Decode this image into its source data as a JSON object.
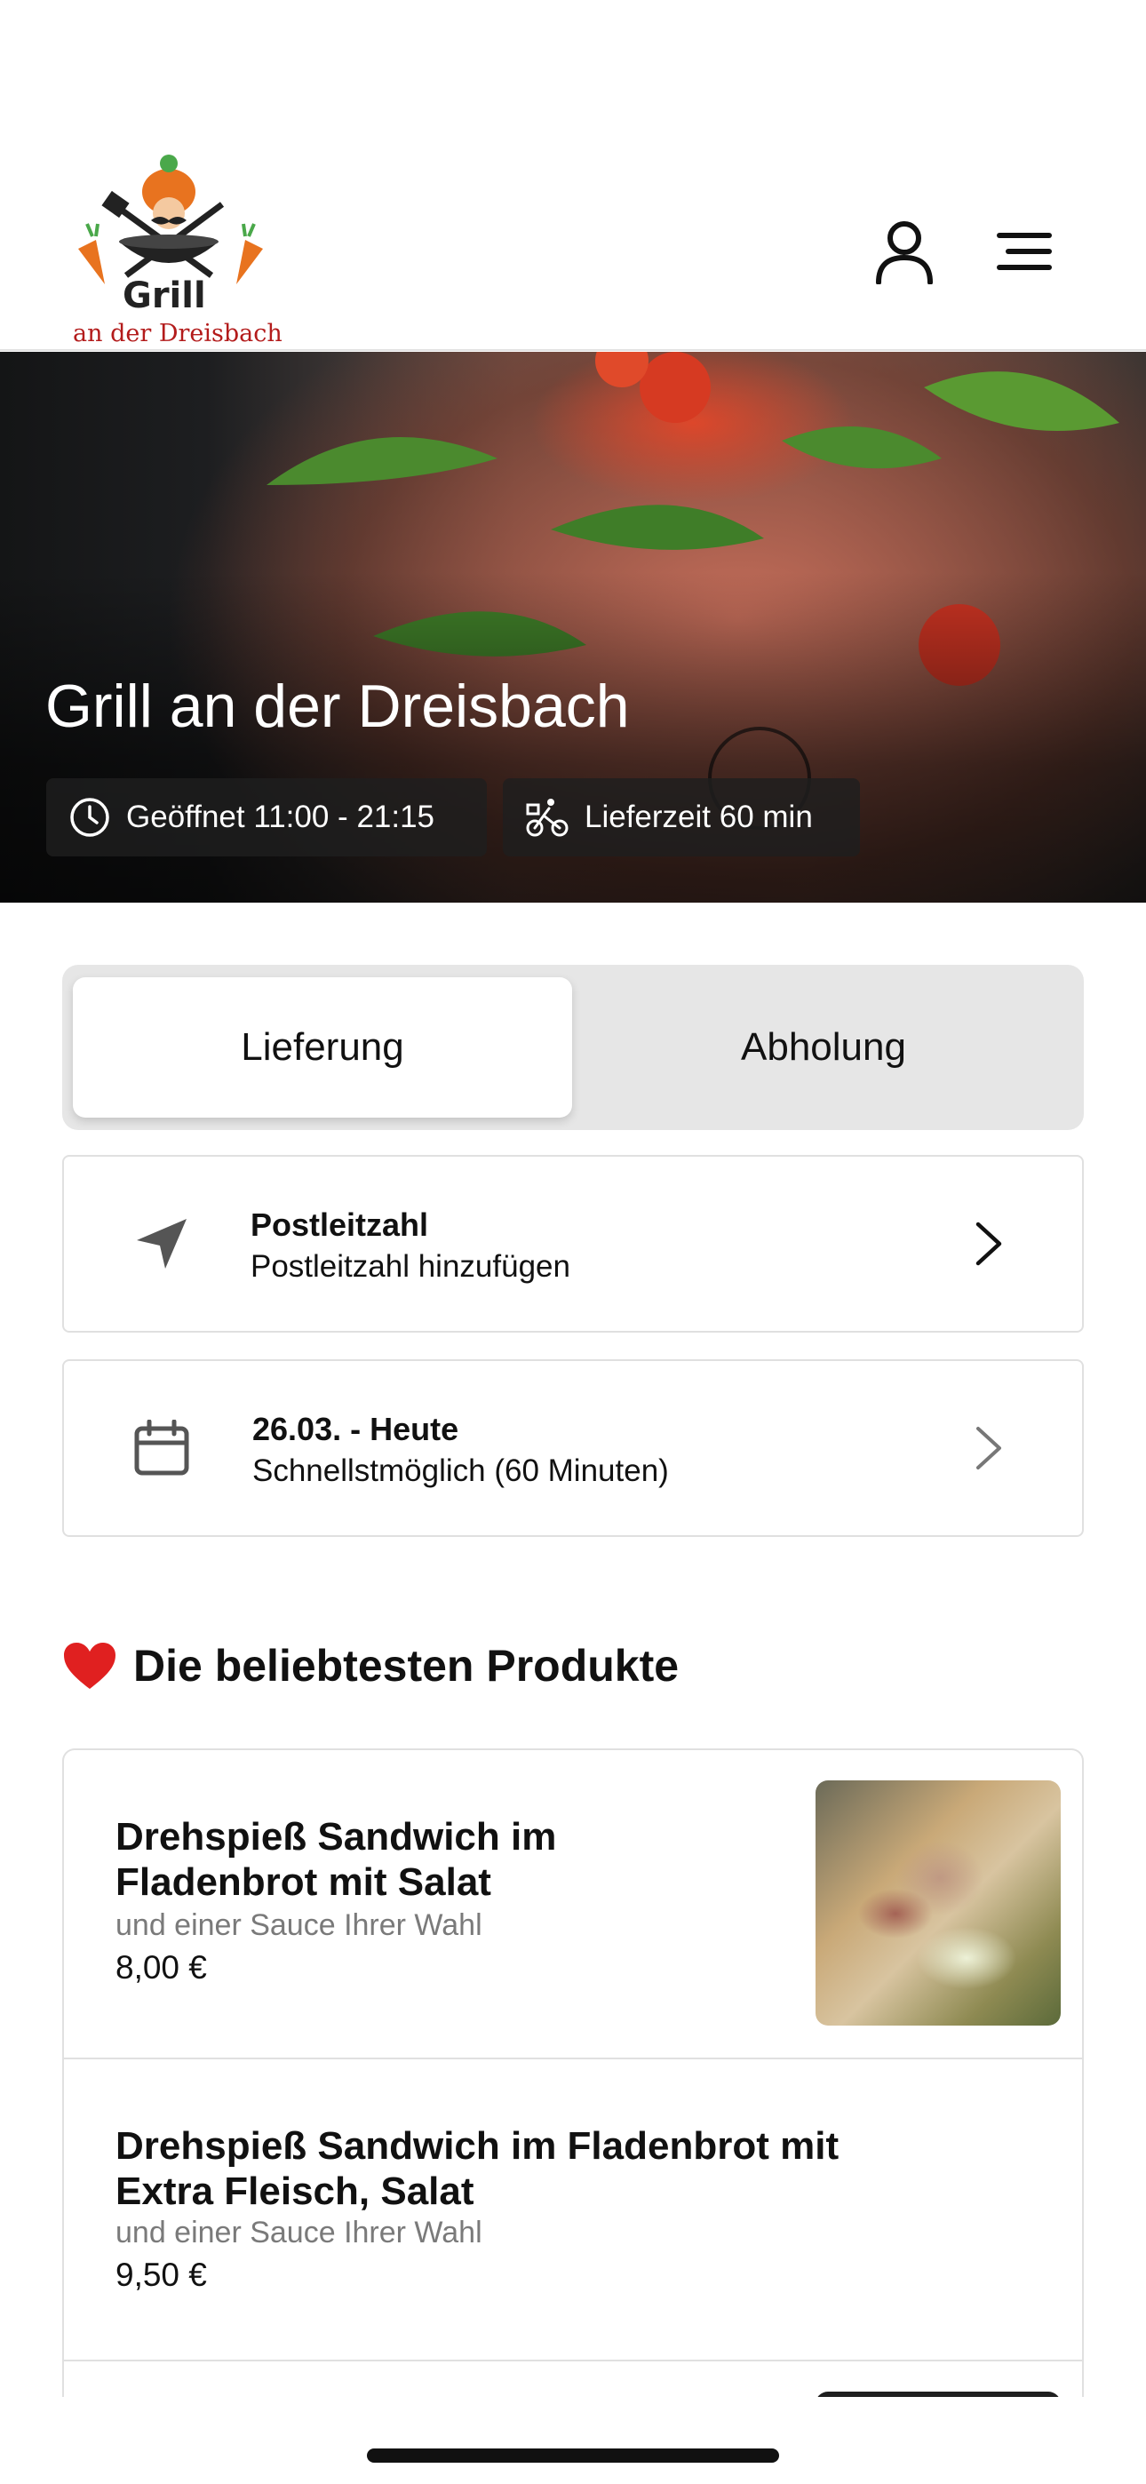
{
  "header": {
    "logo_line1": "Grill",
    "logo_line2": "an der Dreisbach",
    "icons": {
      "user": "user-icon",
      "menu": "hamburger-menu-icon"
    }
  },
  "hero": {
    "title": "Grill an der Dreisbach",
    "opening_hours": "Geöffnet 11:00 - 21:15",
    "delivery_time": "Lieferzeit 60 min",
    "icons": {
      "hours": "clock-icon",
      "delivery": "bicycle-icon"
    }
  },
  "order_mode": {
    "options": [
      "Lieferung",
      "Abholung"
    ],
    "selected": "Lieferung"
  },
  "postal_code": {
    "title": "Postleitzahl",
    "subtitle": "Postleitzahl hinzufügen",
    "icon": "location-arrow-icon"
  },
  "schedule": {
    "title": "26.03. - Heute",
    "subtitle": "Schnellstmöglich (60 Minuten)",
    "icon": "calendar-icon"
  },
  "popular": {
    "emoji": "❤️",
    "title": "Die beliebtesten Produkte",
    "products": [
      {
        "name": "Drehspieß Sandwich im Fladenbrot mit Salat",
        "description": "und einer Sauce Ihrer Wahl",
        "price": "8,00 €"
      },
      {
        "name": "Drehspieß Sandwich im Fladenbrot mit Extra Fleisch, Salat",
        "description": "und einer Sauce Ihrer Wahl",
        "price": "9,50 €"
      }
    ]
  },
  "colors": {
    "accent_red": "#e02020",
    "text": "#111111",
    "muted": "#7a7a7a",
    "border": "#e0e0e0",
    "segment_bg": "#e6e6e6"
  }
}
